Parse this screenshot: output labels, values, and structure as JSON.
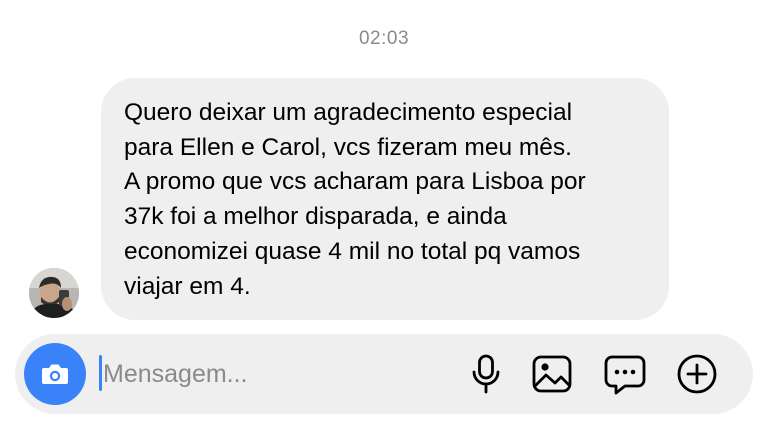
{
  "conversation": {
    "timestamp": "02:03"
  },
  "message": {
    "text": "Quero deixar um agradecimento especial\npara Ellen e Carol, vcs fizeram meu mês.\nA promo que vcs acharam para Lisboa por\n37k foi a melhor disparada, e ainda\neconomizei quase 4 mil no total pq vamos\nviajar em 4.",
    "bubble_color": "#efefef"
  },
  "composer": {
    "placeholder": "Mensagem...",
    "value": "",
    "accent_color": "#3a82f7",
    "icons": [
      "camera-icon",
      "microphone-icon",
      "image-icon",
      "chat-bubble-icon",
      "plus-circle-icon"
    ]
  }
}
